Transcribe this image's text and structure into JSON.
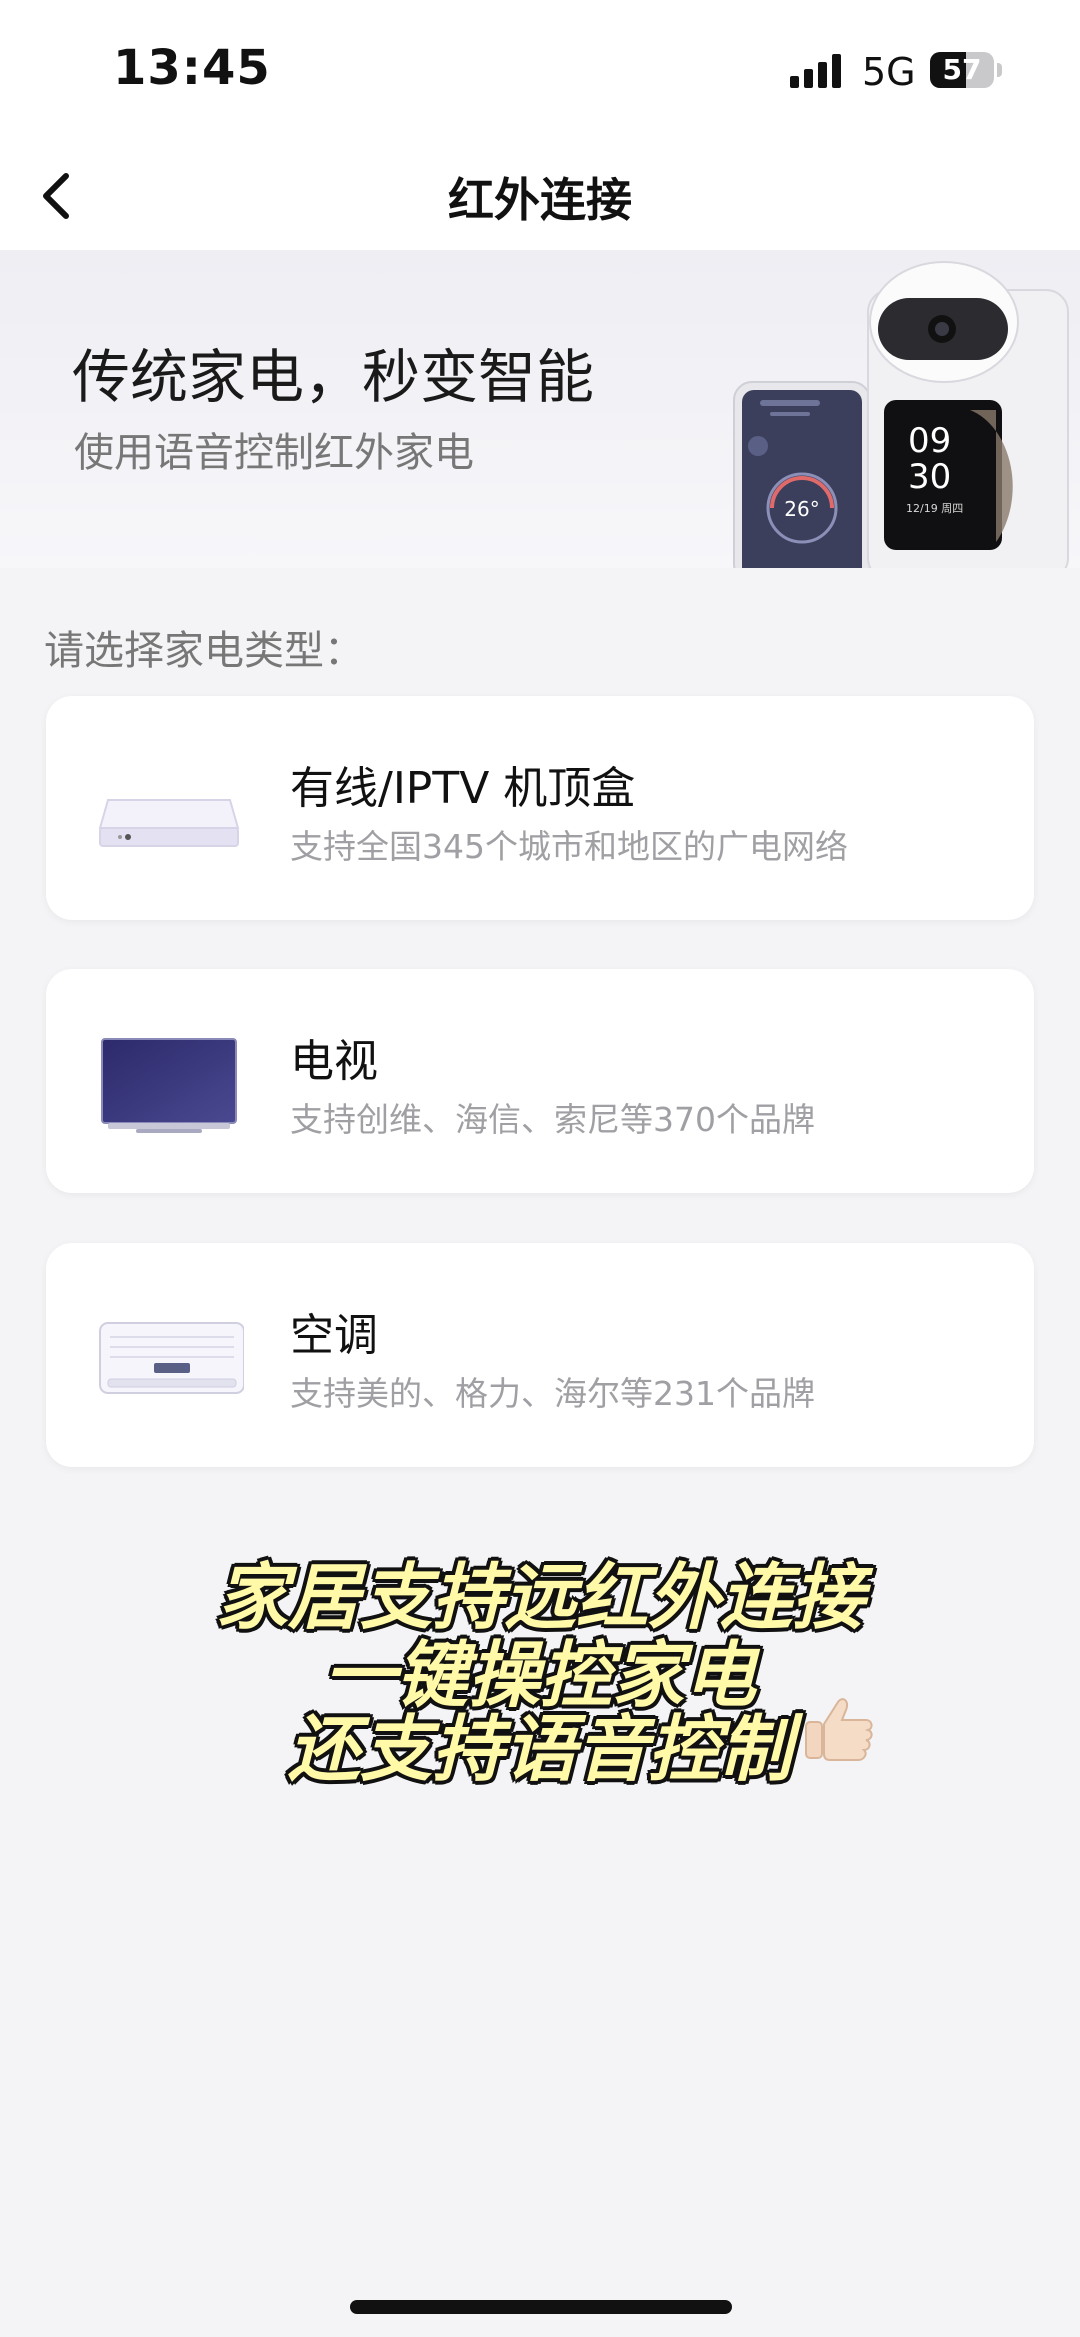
{
  "status_bar": {
    "time": "13:45",
    "network": "5G",
    "battery": "57",
    "battery_level": 0.57,
    "signal_icon": "signal-bars-icon"
  },
  "nav": {
    "title": "红外连接",
    "back_icon": "chevron-left-icon"
  },
  "banner": {
    "title": "传统家电，秒变智能",
    "subtitle": "使用语音控制红外家电",
    "device_clock": [
      "09",
      "30"
    ],
    "device_date": "12/19 周四",
    "phone_temperature": "26°"
  },
  "section_label": "请选择家电类型：",
  "appliances": [
    {
      "title": "有线/IPTV 机顶盒",
      "subtitle": "支持全国345个城市和地区的广电网络",
      "icon": "set-top-box-icon"
    },
    {
      "title": "电视",
      "subtitle": "支持创维、海信、索尼等370个品牌",
      "icon": "tv-icon"
    },
    {
      "title": "空调",
      "subtitle": "支持美的、格力、海尔等231个品牌",
      "icon": "air-conditioner-icon"
    }
  ],
  "caption_lines": [
    "家居支持远红外连接",
    "一键操控家电",
    "还支持语音控制"
  ],
  "caption_emoji": "thumbs-up-icon",
  "colors": {
    "background": "#f4f4f6",
    "card": "#ffffff",
    "caption_fill": "#fff9a8",
    "caption_stroke": "#111111"
  }
}
